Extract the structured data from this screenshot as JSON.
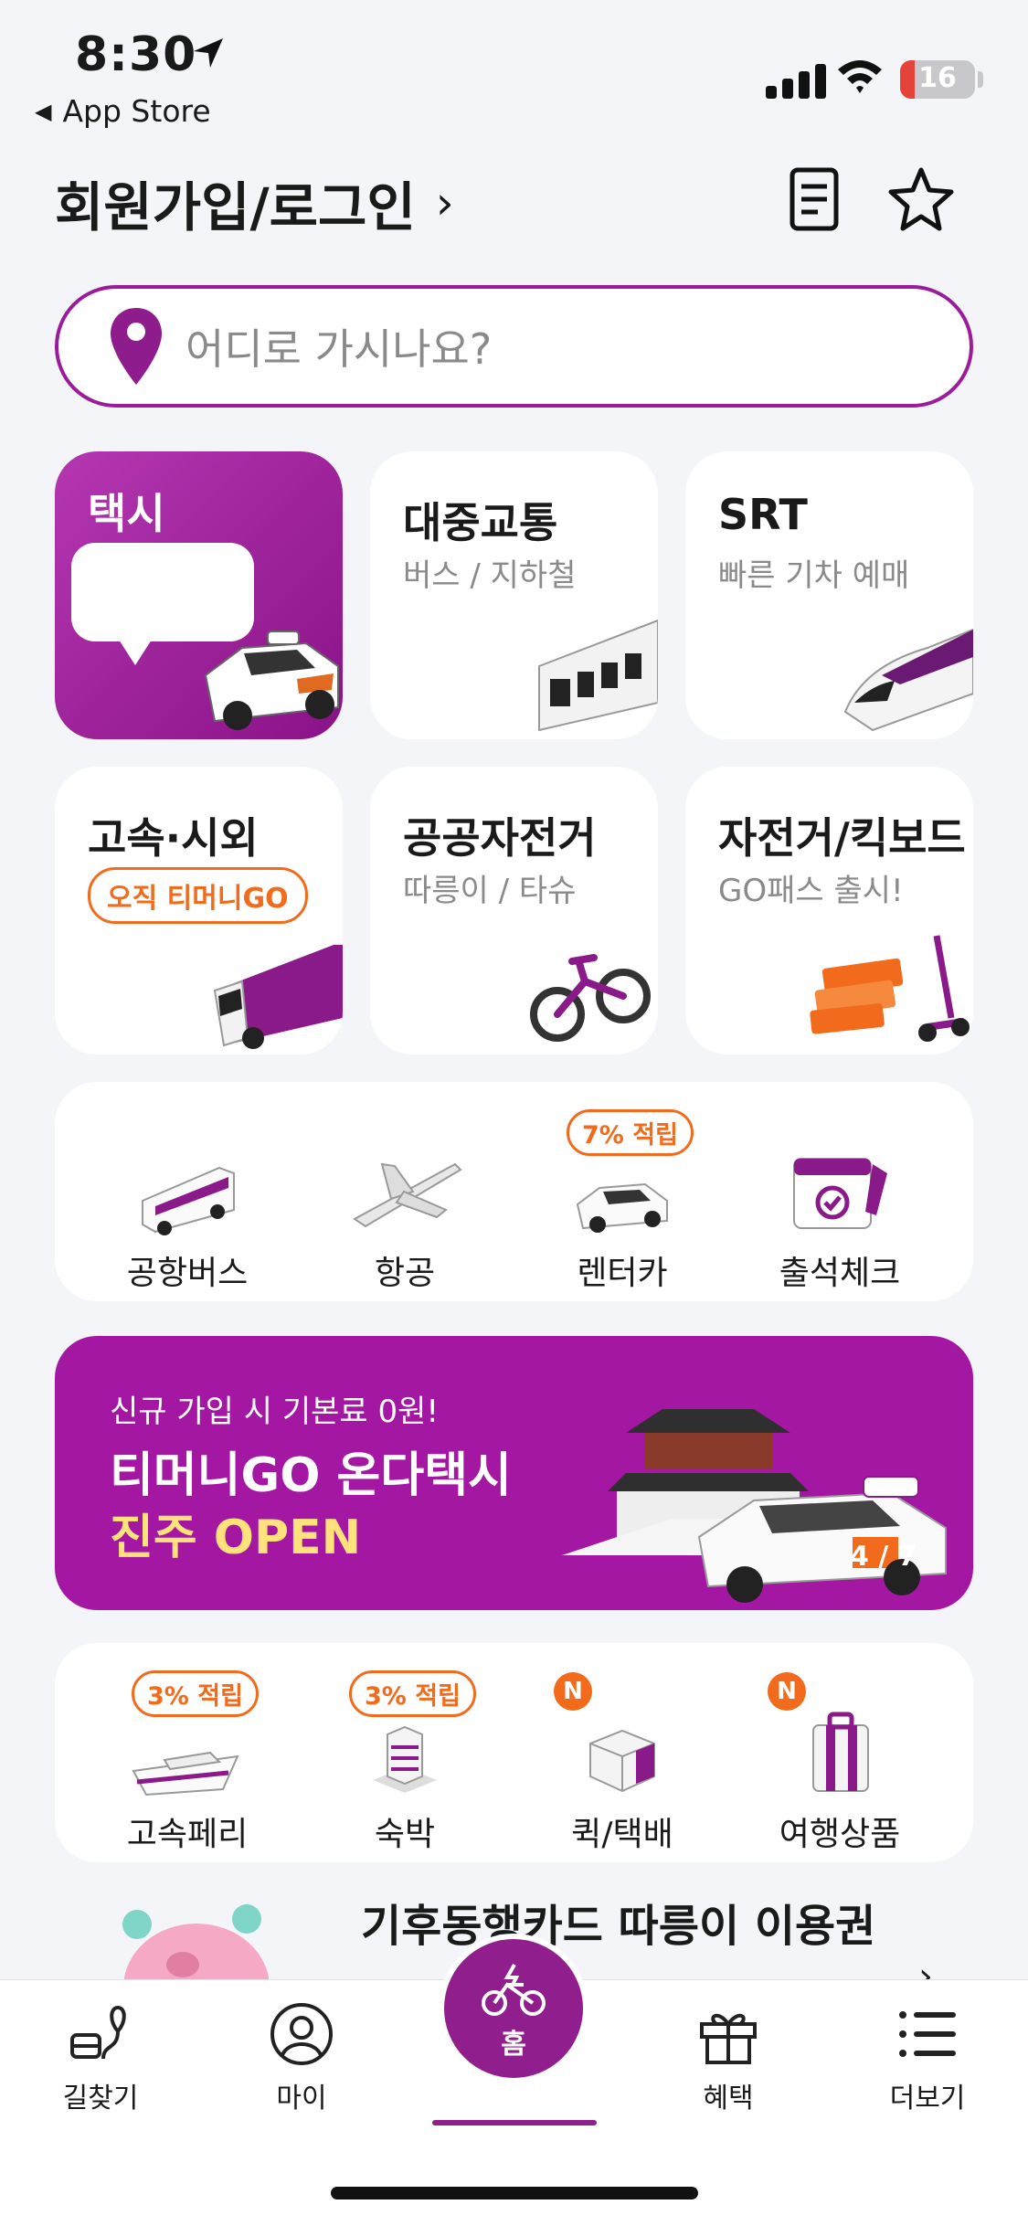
{
  "status_bar": {
    "time": "8:30",
    "back_app": "App Store",
    "battery": "16"
  },
  "header": {
    "title": "회원가입/로그인",
    "chevron": "›"
  },
  "search": {
    "placeholder": "어디로 가시나요?"
  },
  "tiles": [
    {
      "title": "택시",
      "subtitle": ""
    },
    {
      "title": "대중교통",
      "subtitle": "버스 / 지하철"
    },
    {
      "title": "SRT",
      "subtitle": "빠른 기차 예매"
    },
    {
      "title": "고속·시외",
      "subtitle": "",
      "badge": "오직 티머니GO"
    },
    {
      "title": "공공자전거",
      "subtitle": "따릉이 / 타슈"
    },
    {
      "title": "자전거/킥보드",
      "subtitle": "GO패스 출시!"
    }
  ],
  "quick_menu_1": [
    {
      "label": "공항버스"
    },
    {
      "label": "항공"
    },
    {
      "label": "렌터카",
      "badge": "7% 적립"
    },
    {
      "label": "출석체크"
    }
  ],
  "banner": {
    "line1": "신규 가입 시 기본료 0원!",
    "line2": "티머니GO 온다택시",
    "line3": "진주 OPEN",
    "pager": "4 / 7"
  },
  "quick_menu_2": [
    {
      "label": "고속페리",
      "badge": "3% 적립"
    },
    {
      "label": "숙박",
      "badge": "3% 적립"
    },
    {
      "label": "퀵/택배",
      "badge": "N"
    },
    {
      "label": "여행상품",
      "badge": "N"
    }
  ],
  "peek": {
    "title": "기후동행카드 따릉이 이용권"
  },
  "tabbar": [
    {
      "label": "길찾기",
      "icon": "route-icon"
    },
    {
      "label": "마이",
      "icon": "user-icon"
    },
    {
      "label": "홈",
      "icon": "home-bike-icon"
    },
    {
      "label": "혜택",
      "icon": "gift-icon"
    },
    {
      "label": "더보기",
      "icon": "menu-icon"
    }
  ],
  "colors": {
    "brand": "#9c1b9b",
    "accent_orange": "#f26a1b",
    "banner_bg": "#a417a2"
  }
}
